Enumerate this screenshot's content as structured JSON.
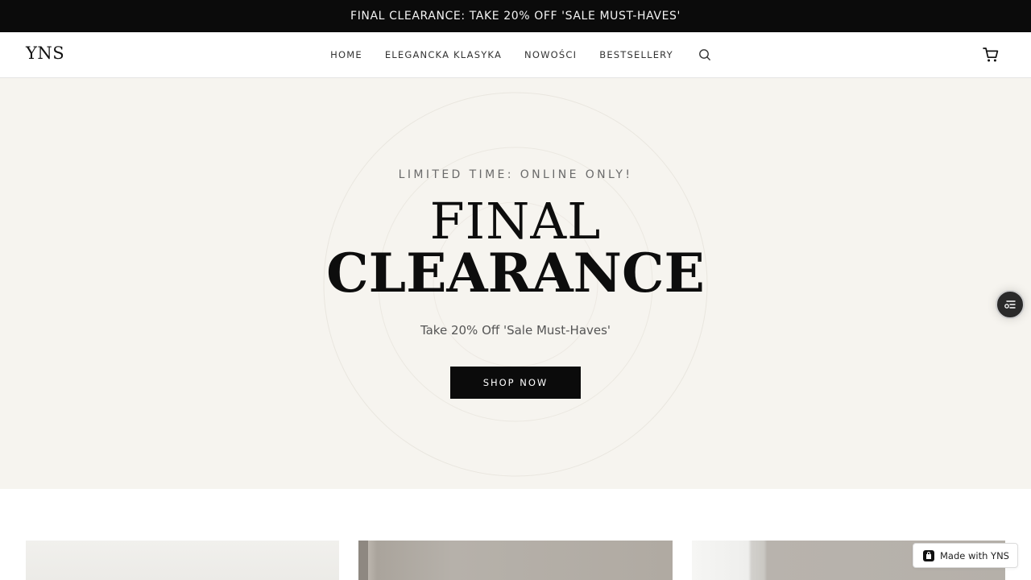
{
  "announcement": {
    "text": "FINAL CLEARANCE: TAKE 20% OFF 'SALE MUST-HAVES'"
  },
  "header": {
    "logo": "YNS",
    "nav": [
      {
        "label": "HOME"
      },
      {
        "label": "ELEGANCKA KLASYKA"
      },
      {
        "label": "NOWOŚCI"
      },
      {
        "label": "BESTSELLERY"
      }
    ],
    "search_icon": "search-icon",
    "cart_icon": "cart-icon"
  },
  "hero": {
    "eyebrow": "LIMITED TIME: ONLINE ONLY!",
    "headline_line1": "FINAL",
    "headline_line2": "CLEARANCE",
    "subline": "Take 20% Off 'Sale Must-Haves'",
    "cta_label": "SHOP NOW",
    "background_color": "#f6f4ef"
  },
  "floating_button": {
    "icon": "settings-list-icon"
  },
  "badge": {
    "label": "Made with YNS",
    "icon": "bag-icon"
  },
  "colors": {
    "dark": "#0b0b0b",
    "hero_bg": "#f6f4ef",
    "white": "#ffffff"
  }
}
